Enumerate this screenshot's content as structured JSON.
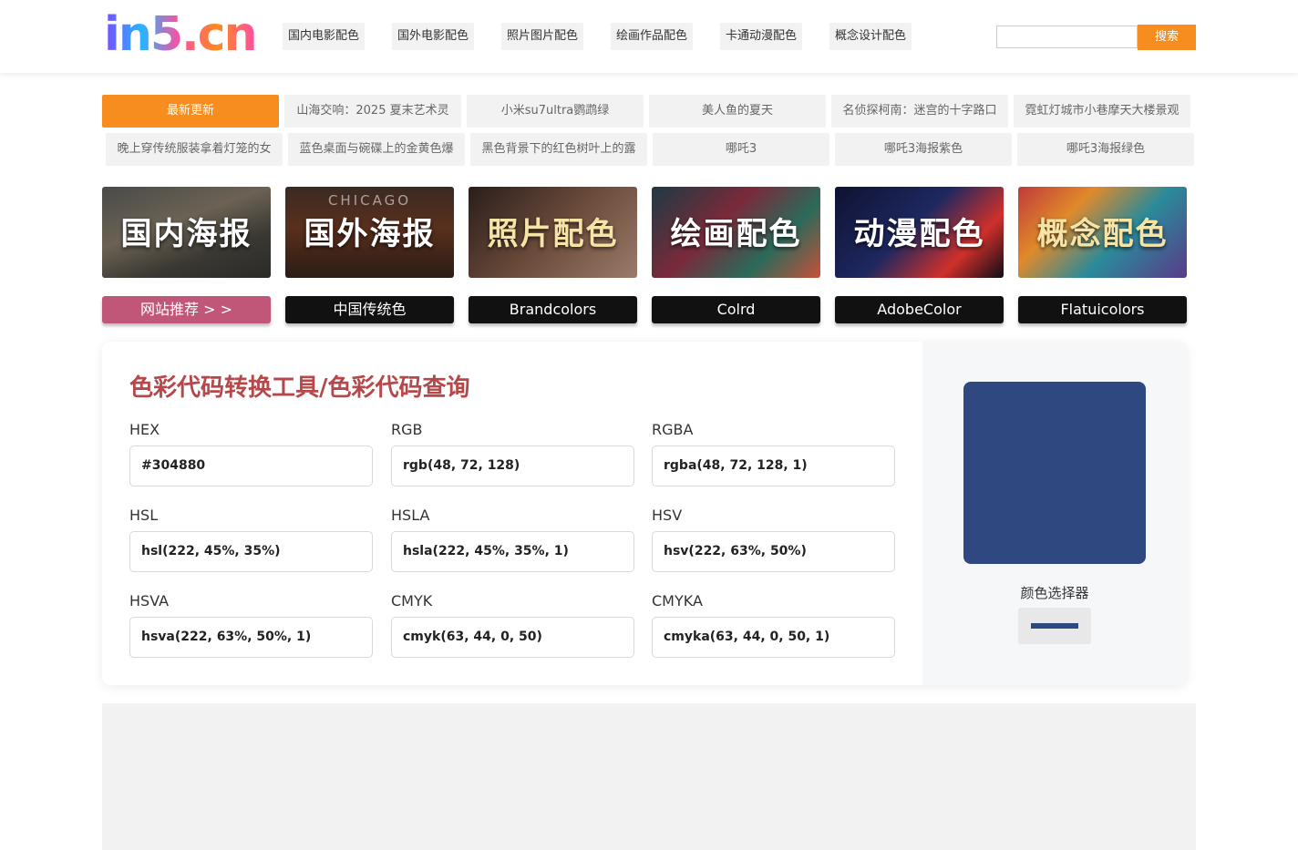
{
  "header": {
    "logo_text": "in5.cn",
    "nav": [
      "国内电影配色",
      "国外电影配色",
      "照片图片配色",
      "绘画作品配色",
      "卡通动漫配色",
      "概念设计配色"
    ],
    "search_placeholder": "",
    "search_button": "搜索"
  },
  "updates": {
    "row1": [
      "最新更新",
      "山海交响：2025 夏末艺术灵",
      "小米su7ultra鹦鹉绿",
      "美人鱼的夏天",
      "名侦探柯南：迷宫的十字路口",
      "霓虹灯城市小巷摩天大楼景观"
    ],
    "row2": [
      "晚上穿传统服装拿着灯笼的女",
      "蓝色桌面与碗碟上的金黄色爆",
      "黑色背景下的红色树叶上的露",
      "哪吒3",
      "哪吒3海报紫色",
      "哪吒3海报绿色"
    ]
  },
  "tiles": [
    {
      "label": "国内海报",
      "sub": ""
    },
    {
      "label": "国外海报",
      "sub": "CHICAGO"
    },
    {
      "label": "照片配色",
      "sub": ""
    },
    {
      "label": "绘画配色",
      "sub": ""
    },
    {
      "label": "动漫配色",
      "sub": ""
    },
    {
      "label": "概念配色",
      "sub": ""
    }
  ],
  "links": [
    "网站推荐 > >",
    "中国传统色",
    "Brandcolors",
    "Colrd",
    "AdobeColor",
    "Flatuicolors"
  ],
  "converter": {
    "title": "色彩代码转换工具/色彩代码查询",
    "fields": [
      {
        "label": "HEX",
        "value": "#304880"
      },
      {
        "label": "RGB",
        "value": "rgb(48, 72, 128)"
      },
      {
        "label": "RGBA",
        "value": "rgba(48, 72, 128, 1)"
      },
      {
        "label": "HSL",
        "value": "hsl(222, 45%, 35%)"
      },
      {
        "label": "HSLA",
        "value": "hsla(222, 45%, 35%, 1)"
      },
      {
        "label": "HSV",
        "value": "hsv(222, 63%, 50%)"
      },
      {
        "label": "HSVA",
        "value": "hsva(222, 63%, 50%, 1)"
      },
      {
        "label": "CMYK",
        "value": "cmyk(63, 44, 0, 50)"
      },
      {
        "label": "CMYKA",
        "value": "cmyka(63, 44, 0, 50, 1)"
      }
    ],
    "swatch_color": "#304880",
    "picker_label": "颜色选择器"
  },
  "colors": {
    "accent_orange": "#f68d1e",
    "title_red": "#b5484a",
    "link_pink": "#c05678"
  }
}
